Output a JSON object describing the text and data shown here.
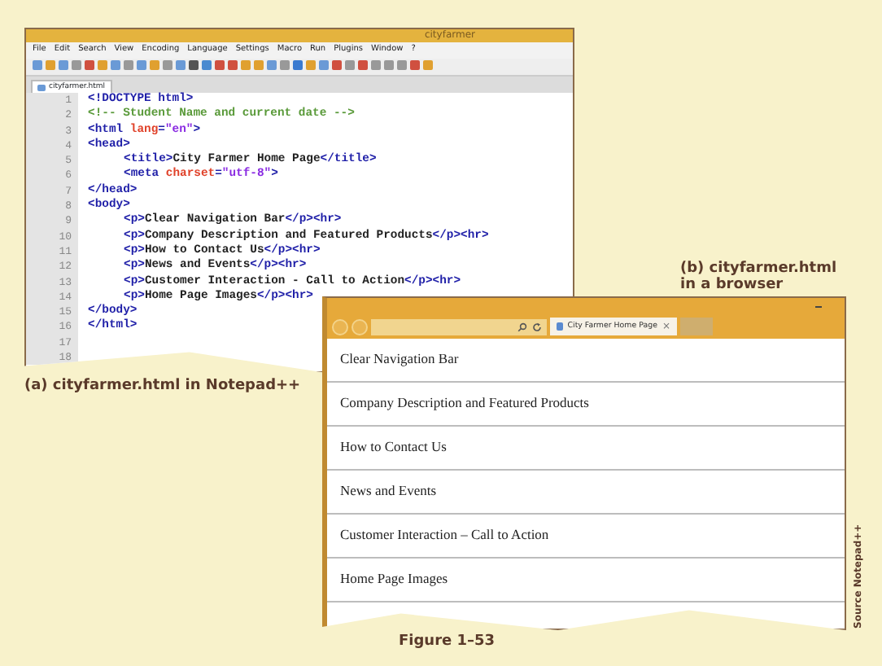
{
  "editor": {
    "title": "cityfarmer",
    "menu": [
      "File",
      "Edit",
      "Search",
      "View",
      "Encoding",
      "Language",
      "Settings",
      "Macro",
      "Run",
      "Plugins",
      "Window",
      "?"
    ],
    "tab": {
      "label": "cityfarmer.html"
    },
    "lines": [
      {
        "number": "1",
        "tokens": [
          {
            "kind": "tag",
            "text": "<!DOCTYPE html>"
          }
        ]
      },
      {
        "number": "2",
        "tokens": [
          {
            "kind": "comment",
            "text": "<!-- Student Name and current date -->"
          }
        ]
      },
      {
        "number": "3",
        "tokens": [
          {
            "kind": "tag",
            "text": "<html "
          },
          {
            "kind": "attr",
            "text": "lang"
          },
          {
            "kind": "tag",
            "text": "="
          },
          {
            "kind": "value",
            "text": "\"en\""
          },
          {
            "kind": "tag",
            "text": ">"
          }
        ]
      },
      {
        "number": "4",
        "tokens": [
          {
            "kind": "tag",
            "text": "<head>"
          }
        ]
      },
      {
        "number": "5",
        "indented": true,
        "tokens": [
          {
            "kind": "tag",
            "text": "<title>"
          },
          {
            "kind": "text",
            "text": "City Farmer Home Page"
          },
          {
            "kind": "tag",
            "text": "</title>"
          }
        ]
      },
      {
        "number": "6",
        "indented": true,
        "tokens": [
          {
            "kind": "tag",
            "text": "<meta "
          },
          {
            "kind": "attr",
            "text": "charset"
          },
          {
            "kind": "tag",
            "text": "="
          },
          {
            "kind": "value",
            "text": "\"utf-8\""
          },
          {
            "kind": "tag",
            "text": ">"
          }
        ]
      },
      {
        "number": "7",
        "tokens": [
          {
            "kind": "tag",
            "text": "</head>"
          }
        ]
      },
      {
        "number": "8",
        "tokens": [
          {
            "kind": "tag",
            "text": "<body>"
          }
        ]
      },
      {
        "number": "9",
        "indented": true,
        "tokens": [
          {
            "kind": "tag",
            "text": "<p>"
          },
          {
            "kind": "text",
            "text": "Clear Navigation Bar"
          },
          {
            "kind": "tag",
            "text": "</p><hr>"
          }
        ]
      },
      {
        "number": "10",
        "indented": true,
        "tokens": [
          {
            "kind": "tag",
            "text": "<p>"
          },
          {
            "kind": "text",
            "text": "Company Description and Featured Products"
          },
          {
            "kind": "tag",
            "text": "</p><hr>"
          }
        ]
      },
      {
        "number": "11",
        "indented": true,
        "tokens": [
          {
            "kind": "tag",
            "text": "<p>"
          },
          {
            "kind": "text",
            "text": "How to Contact Us"
          },
          {
            "kind": "tag",
            "text": "</p><hr>"
          }
        ]
      },
      {
        "number": "12",
        "indented": true,
        "tokens": [
          {
            "kind": "tag",
            "text": "<p>"
          },
          {
            "kind": "text",
            "text": "News and Events"
          },
          {
            "kind": "tag",
            "text": "</p><hr>"
          }
        ]
      },
      {
        "number": "13",
        "indented": true,
        "tokens": [
          {
            "kind": "tag",
            "text": "<p>"
          },
          {
            "kind": "text",
            "text": "Customer Interaction - Call to Action"
          },
          {
            "kind": "tag",
            "text": "</p><hr>"
          }
        ]
      },
      {
        "number": "14",
        "indented": true,
        "tokens": [
          {
            "kind": "tag",
            "text": "<p>"
          },
          {
            "kind": "text",
            "text": "Home Page Images"
          },
          {
            "kind": "tag",
            "text": "</p><hr>"
          }
        ]
      },
      {
        "number": "15",
        "tokens": [
          {
            "kind": "tag",
            "text": "</body>"
          }
        ]
      },
      {
        "number": "16",
        "tokens": [
          {
            "kind": "tag",
            "text": "</html>"
          }
        ]
      },
      {
        "number": "17"
      },
      {
        "number": "18"
      }
    ]
  },
  "editor_caption": "(a) cityfarmer.html in Notepad++",
  "browser_caption": [
    "(b) cityfarmer.html",
    "in a browser"
  ],
  "browser": {
    "tab": {
      "label": "City Farmer Home Page",
      "close": "×"
    },
    "paragraphs": [
      "Clear Navigation Bar",
      "Company Description and Featured Products",
      "How to Contact Us",
      "News and Events",
      "Customer Interaction – Call to Action",
      "Home Page Images"
    ]
  },
  "figure_label": "Figure 1–53",
  "source_credit": "Source Notepad++"
}
